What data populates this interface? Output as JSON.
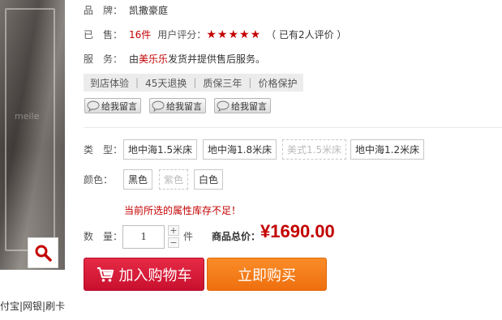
{
  "gallery": {
    "watermark": "meile",
    "zoom_icon": "magnifier-icon"
  },
  "brand": {
    "label": "品　牌：",
    "value": "凯撒豪庭"
  },
  "sales": {
    "label": "已　售：",
    "value": "16件",
    "rating_label": "用户评分：",
    "stars": 5,
    "star_glyph": "★",
    "review_text": "（ 已有2人评价 ）"
  },
  "service": {
    "label": "服　务：",
    "prefix": "由 ",
    "seller": "美乐乐",
    "suffix": " 发货并提供售后服务。"
  },
  "service_tags": [
    "到店体验",
    "45天退换",
    "质保三年",
    "价格保护"
  ],
  "message_buttons": [
    "给我留言",
    "给我留言",
    "给我留言"
  ],
  "type_option": {
    "label": "类　型：",
    "options": [
      "地中海1.5米床",
      "地中海1.8米床",
      "美式1.5米床",
      "地中海1.2米床"
    ]
  },
  "color_option": {
    "label": "颜色：",
    "options": [
      "黑色",
      "紫色",
      "白色"
    ]
  },
  "stock_warning": "当前所选的属性库存不足！",
  "quantity": {
    "label": "数　量：",
    "value": "1",
    "unit": "件",
    "increase": "+",
    "decrease": "−"
  },
  "total": {
    "label": "商品总价：",
    "price": "¥1690.00"
  },
  "actions": {
    "add_to_cart": "加入购物车",
    "buy_now": "立即购买"
  },
  "payment_text": "付宝|网银|刷卡",
  "colors": {
    "accent_red": "#c40000",
    "cart_red": "#d71a37",
    "buy_orange": "#f5801c"
  }
}
